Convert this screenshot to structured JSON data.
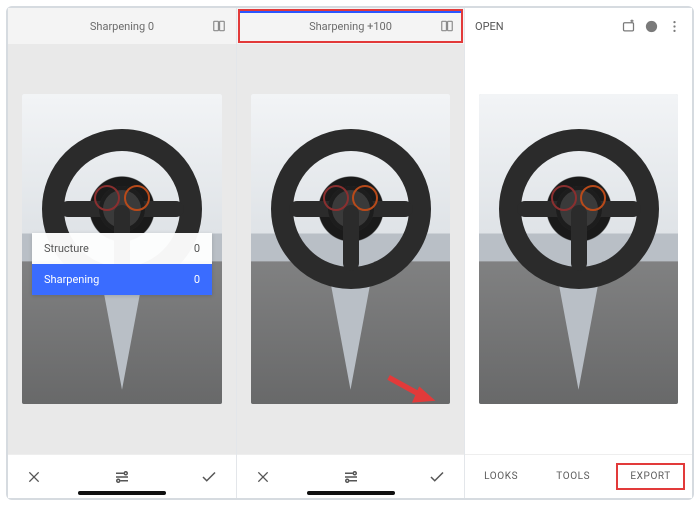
{
  "panel1": {
    "header_label": "Sharpening 0",
    "adjust": {
      "structure_label": "Structure",
      "structure_value": "0",
      "sharpening_label": "Sharpening",
      "sharpening_value": "0"
    }
  },
  "panel2": {
    "header_label": "Sharpening +100"
  },
  "panel3": {
    "open_label": "OPEN",
    "nav": {
      "looks": "LOOKS",
      "tools": "TOOLS",
      "export": "EXPORT"
    }
  }
}
